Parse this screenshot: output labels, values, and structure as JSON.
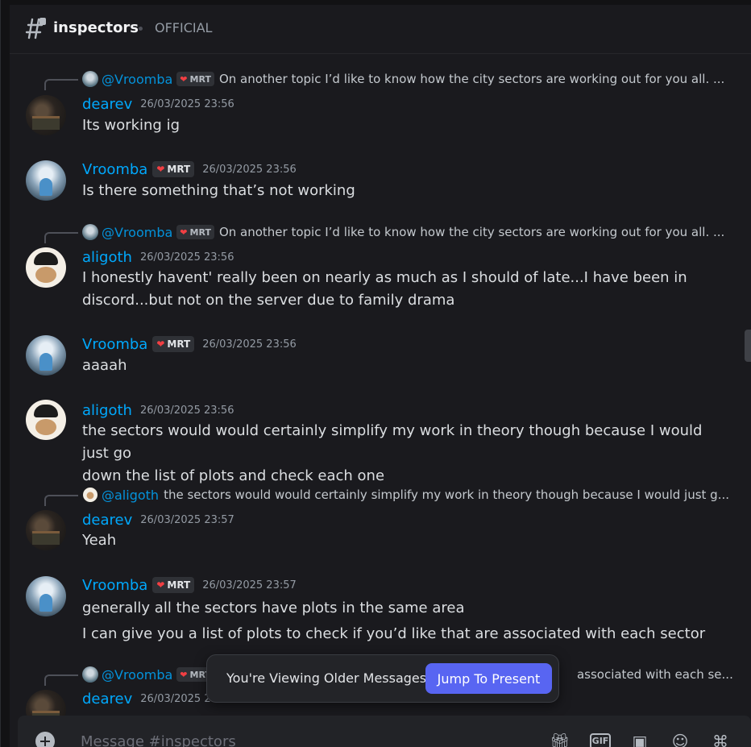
{
  "channel": {
    "name": "inspectors",
    "topic": "OFFICIAL"
  },
  "messages": [
    {
      "reply": {
        "name": "@Vroomba",
        "tag": "MRT",
        "text": "On another topic I’d like to know how the city sectors are working out for you all. ..."
      },
      "author": "dearev",
      "timestamp": "26/03/2025 23:56",
      "lines": [
        "Its working ig"
      ]
    },
    {
      "author": "Vroomba",
      "tag": "MRT",
      "timestamp": "26/03/2025 23:56",
      "lines": [
        "Is there something that’s not working"
      ]
    },
    {
      "reply": {
        "name": "@Vroomba",
        "tag": "MRT",
        "text": "On another topic I’d like to know how the city sectors are working out for you all. ..."
      },
      "author": "aligoth",
      "timestamp": "26/03/2025 23:56",
      "lines": [
        "I honestly havent' really been on nearly as much as I should of late...I have been in",
        "discord...but not on the server due to family drama"
      ]
    },
    {
      "author": "Vroomba",
      "tag": "MRT",
      "timestamp": "26/03/2025 23:56",
      "lines": [
        "aaaah"
      ]
    },
    {
      "author": "aligoth",
      "timestamp": "26/03/2025 23:56",
      "lines": [
        "the sectors would would certainly simplify my work in theory though because I would just go",
        "down the list of plots and check each one"
      ]
    },
    {
      "reply": {
        "name": "@aligoth",
        "text": "the sectors would would certainly simplify my work in theory though because I would just g..."
      },
      "author": "dearev",
      "timestamp": "26/03/2025 23:57",
      "lines": [
        "Yeah"
      ]
    },
    {
      "author": "Vroomba",
      "tag": "MRT",
      "timestamp": "26/03/2025 23:57",
      "lines": [
        "generally all the sectors have plots in the same area",
        "I can give you a list of plots to check if you’d like that are associated with each sector"
      ]
    },
    {
      "reply": {
        "name": "@Vroomba",
        "tag": "MRT",
        "text": "associated with each se..."
      },
      "author": "dearev",
      "timestamp": "26/03/2025 23:5"
    }
  ],
  "older_banner": {
    "label": "You're Viewing Older Messages",
    "button": "Jump To Present"
  },
  "composer": {
    "placeholder": "Message #inspectors",
    "tools": [
      "gift-icon",
      "gif-icon",
      "sticker-icon",
      "emoji-icon",
      "apps-icon"
    ],
    "gif_label": "GIF"
  },
  "colors": {
    "accent": "#5865f2",
    "username": "#00a8fc",
    "background": "#1a1a1e"
  }
}
